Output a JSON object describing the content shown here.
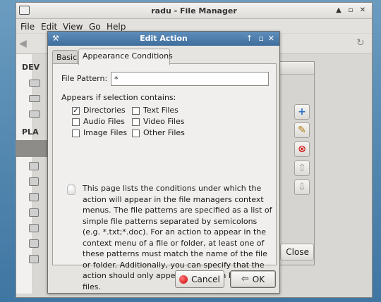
{
  "file_manager": {
    "title": "radu - File Manager",
    "menu": [
      {
        "label": "File"
      },
      {
        "label": "Edit"
      },
      {
        "label": "View"
      },
      {
        "label": "Go"
      },
      {
        "label": "Help"
      }
    ],
    "sidebar": {
      "devices_label": "DEV",
      "places_label": "PLA"
    }
  },
  "actions_window": {
    "close_label": "Close"
  },
  "dialog": {
    "title": "Edit Action",
    "tabs": [
      {
        "label": "Basic"
      },
      {
        "label": "Appearance Conditions"
      }
    ],
    "file_pattern": {
      "label": "File Pattern:",
      "value": "*"
    },
    "appears_label": "Appears if selection contains:",
    "checkboxes": [
      {
        "label": "Directories",
        "checked": true
      },
      {
        "label": "Text Files",
        "checked": false
      },
      {
        "label": "Audio Files",
        "checked": false
      },
      {
        "label": "Video Files",
        "checked": false
      },
      {
        "label": "Image Files",
        "checked": false
      },
      {
        "label": "Other Files",
        "checked": false
      }
    ],
    "help_text": "This page lists the conditions under which the action will appear in the file managers context menus. The file patterns are specified as a list of simple file patterns separated by semicolons (e.g. *.txt;*.doc). For an action to appear in the context menu of a file or folder, at least one of these patterns must match the name of the file or folder. Additionally, you can specify that the action should only appear for certain kinds of files.",
    "cancel_label": "Cancel",
    "ok_label": "OK"
  }
}
